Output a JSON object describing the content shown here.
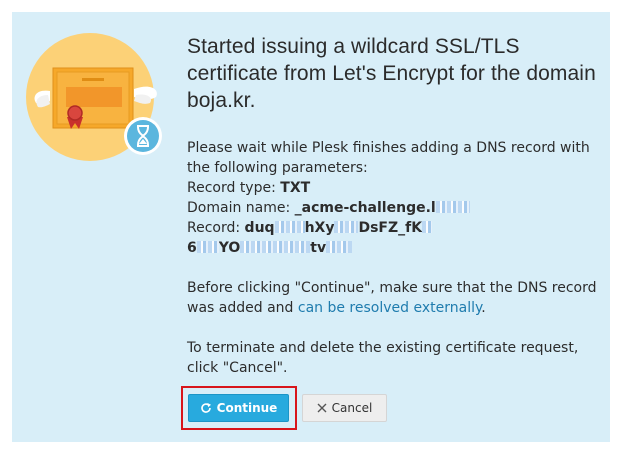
{
  "title": "Started issuing a wildcard SSL/TLS certificate from Let's Encrypt for the domain boja.kr.",
  "intro": "Please wait while Plesk finishes adding a DNS record with the following parameters:",
  "record_type_label": "Record type:",
  "record_type_value": "TXT",
  "domain_name_label": "Domain name:",
  "domain_name_value": "_acme-challenge.l",
  "record_label": "Record:",
  "record_value_part1": "duq",
  "record_value_part2": "hXy",
  "record_value_part3": "DsFZ_fK",
  "record_value_line2_a": "6",
  "record_value_line2_b": "YO",
  "record_value_line2_c": "tv",
  "before_text": "Before clicking \"Continue\", make sure that the DNS record was added and ",
  "resolve_link": "can be resolved externally",
  "before_text_end": ".",
  "terminate_text": "To terminate and delete the existing certificate request, click \"Cancel\".",
  "buttons": {
    "continue_label": "Continue",
    "cancel_label": "Cancel"
  },
  "colors": {
    "panel": "#d8eef8",
    "circle": "#fcd177",
    "certificate": "#f6a82a",
    "primary_button": "#28aade",
    "highlight": "#d8151b",
    "link": "#1f7cae"
  },
  "icons": {
    "continue": "refresh-icon",
    "cancel": "close-icon",
    "badge": "hourglass-icon"
  }
}
